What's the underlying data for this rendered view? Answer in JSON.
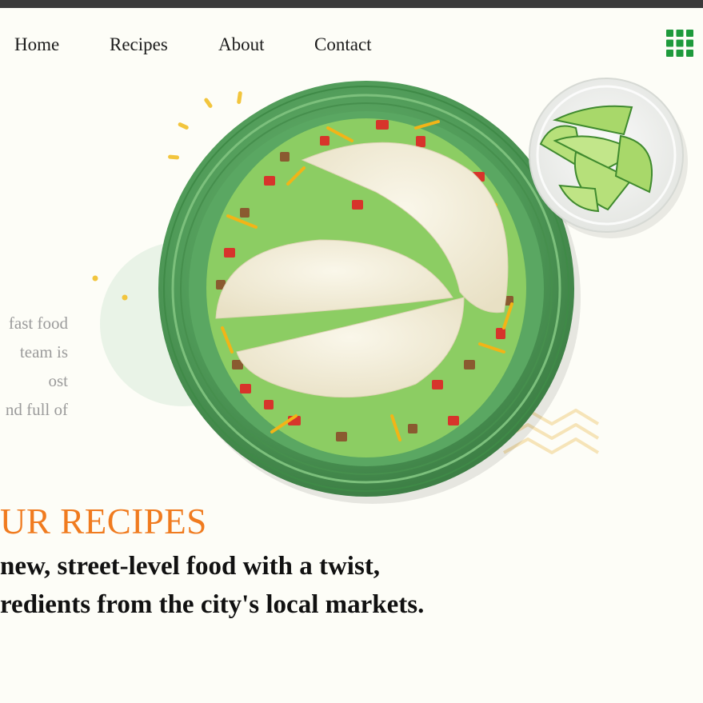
{
  "nav": {
    "items": [
      {
        "label": "Home"
      },
      {
        "label": "Recipes"
      },
      {
        "label": "About"
      },
      {
        "label": "Contact"
      }
    ],
    "menu_icon": "grid-menu-icon",
    "menu_icon_color": "#1e9a3c"
  },
  "hero": {
    "description_lines": [
      "fast food",
      "team is",
      "ost",
      "nd full of"
    ],
    "image_subject": "tacos-on-green-plate",
    "side_image_subject": "lime-wedges-in-glass-bowl"
  },
  "recipes_section": {
    "title": "UR RECIPES",
    "subtitle_lines": [
      "new, street-level food with a twist,",
      "redients from the city's local markets."
    ]
  },
  "colors": {
    "accent": "#f07b1f",
    "background": "#fdfdf7",
    "top_bar": "#3a3a3a",
    "plate": "#4f9a58",
    "decor_dots": "#f2c53d"
  }
}
